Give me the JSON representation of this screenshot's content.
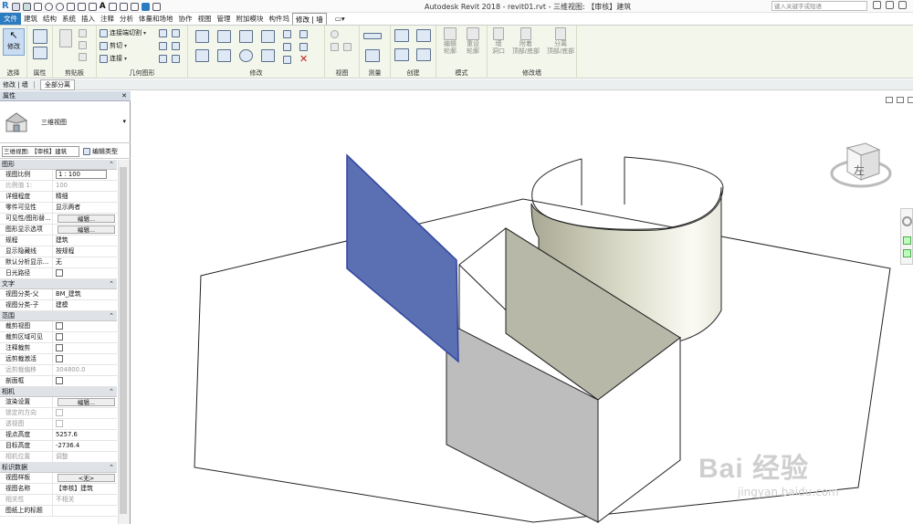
{
  "app": {
    "title": "Autodesk Revit 2018 -     revit01.rvt - 三维视图: 【审核】建筑",
    "search_placeholder": "键入关键字或短语"
  },
  "menu": {
    "tabs": [
      "文件",
      "建筑",
      "结构",
      "系统",
      "插入",
      "注释",
      "分析",
      "体量和场地",
      "协作",
      "视图",
      "管理",
      "附加模块",
      "构件坞",
      "修改 | 墙"
    ],
    "active": "修改 | 墙"
  },
  "ribbon": {
    "groups": {
      "select": "选择",
      "properties": "属性",
      "clipboard": "剪贴板",
      "geometry": "几何图形",
      "modify": "修改",
      "view": "视图",
      "measure": "测量",
      "create": "创建",
      "mode": "模式",
      "modify_wall": "修改墙"
    },
    "modify_button": "修改",
    "join_geometry": "连接端切割",
    "cut": "剪切",
    "join": "连接",
    "mode_buttons": [
      "编辑\n轮廓",
      "重设\n轮廓"
    ],
    "wall_buttons": [
      "墙\n洞口",
      "附着\n顶部/底部",
      "分离\n顶部/底部"
    ]
  },
  "context": {
    "label": "修改 | 墙",
    "button": "全部分离"
  },
  "properties": {
    "title": "属性",
    "type_name": "三维视图",
    "view_select": "三维视图: 【审核】建筑",
    "edit_type": "编辑类型",
    "categories": [
      {
        "name": "图形",
        "rows": [
          {
            "label": "视图比例",
            "value": "1 : 100",
            "kind": "input"
          },
          {
            "label": "比例值 1:",
            "value": "100",
            "kind": "dis"
          },
          {
            "label": "详细程度",
            "value": "精细"
          },
          {
            "label": "零件可见性",
            "value": "显示两者"
          },
          {
            "label": "可见性/图形替...",
            "value": "编辑...",
            "kind": "btn"
          },
          {
            "label": "图形显示选项",
            "value": "编辑...",
            "kind": "btn"
          },
          {
            "label": "规程",
            "value": "建筑"
          },
          {
            "label": "显示隐藏线",
            "value": "按规程"
          },
          {
            "label": "默认分析显示...",
            "value": "无"
          },
          {
            "label": "日光路径",
            "value": "",
            "kind": "cb"
          }
        ]
      },
      {
        "name": "文字",
        "rows": [
          {
            "label": "视图分类-父",
            "value": "BM_建筑"
          },
          {
            "label": "视图分类-子",
            "value": "建模"
          }
        ]
      },
      {
        "name": "范围",
        "rows": [
          {
            "label": "裁剪视图",
            "value": "",
            "kind": "cb"
          },
          {
            "label": "裁剪区域可见",
            "value": "",
            "kind": "cb"
          },
          {
            "label": "注释裁剪",
            "value": "",
            "kind": "cb"
          },
          {
            "label": "远剪裁激活",
            "value": "",
            "kind": "cb"
          },
          {
            "label": "远剪裁偏移",
            "value": "304800.0",
            "kind": "dis"
          },
          {
            "label": "剖面框",
            "value": "",
            "kind": "cb"
          }
        ]
      },
      {
        "name": "相机",
        "rows": [
          {
            "label": "渲染设置",
            "value": "编辑...",
            "kind": "btn"
          },
          {
            "label": "锁定的方向",
            "value": "",
            "kind": "cbdis"
          },
          {
            "label": "透视图",
            "value": "",
            "kind": "cbdis"
          },
          {
            "label": "视点高度",
            "value": "5257.6"
          },
          {
            "label": "目标高度",
            "value": "-2736.4"
          },
          {
            "label": "相机位置",
            "value": "调整",
            "kind": "dis"
          }
        ]
      },
      {
        "name": "标识数据",
        "rows": [
          {
            "label": "视图样板",
            "value": "<无>",
            "kind": "btn"
          },
          {
            "label": "视图名称",
            "value": "【审核】建筑"
          },
          {
            "label": "相关性",
            "value": "不相关",
            "kind": "dis"
          },
          {
            "label": "图纸上的标题",
            "value": ""
          }
        ]
      }
    ]
  },
  "viewcube": {
    "face": "左"
  },
  "watermark": {
    "main": "Bai 经验",
    "sub": "jingyan.baidu.com"
  },
  "colors": {
    "selected_wall": "#5b6fb3",
    "wall_face": "#b8b8a8",
    "accent": "#2b7bc1"
  }
}
